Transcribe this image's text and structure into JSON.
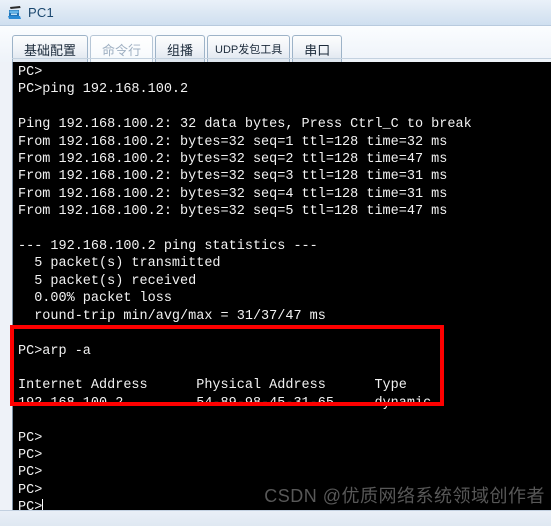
{
  "window": {
    "title": "PC1",
    "icon": "pc-device-icon"
  },
  "tabs": [
    {
      "label": "基础配置",
      "active": false,
      "name": "tab-basic-config"
    },
    {
      "label": "命令行",
      "active": true,
      "name": "tab-command-line"
    },
    {
      "label": "组播",
      "active": false,
      "name": "tab-multicast"
    },
    {
      "label": "UDP发包工具",
      "active": false,
      "name": "tab-udp-packet-tool"
    },
    {
      "label": "串口",
      "active": false,
      "name": "tab-serial-port"
    }
  ],
  "terminal": {
    "prompt": "PC>",
    "content": "PC>\nPC>ping 192.168.100.2\n\nPing 192.168.100.2: 32 data bytes, Press Ctrl_C to break\nFrom 192.168.100.2: bytes=32 seq=1 ttl=128 time=32 ms\nFrom 192.168.100.2: bytes=32 seq=2 ttl=128 time=47 ms\nFrom 192.168.100.2: bytes=32 seq=3 ttl=128 time=31 ms\nFrom 192.168.100.2: bytes=32 seq=4 ttl=128 time=31 ms\nFrom 192.168.100.2: bytes=32 seq=5 ttl=128 time=47 ms\n\n--- 192.168.100.2 ping statistics ---\n  5 packet(s) transmitted\n  5 packet(s) received\n  0.00% packet loss\n  round-trip min/avg/max = 31/37/47 ms\n\nPC>arp -a\n\nInternet Address      Physical Address      Type\n192.168.100.2         54-89-98-45-31-65     dynamic\n\nPC>\nPC>\nPC>\nPC>\nPC>",
    "ping_command": "ping 192.168.100.2",
    "ping_header": "Ping 192.168.100.2: 32 data bytes, Press Ctrl_C to break",
    "ping_replies": [
      "From 192.168.100.2: bytes=32 seq=1 ttl=128 time=32 ms",
      "From 192.168.100.2: bytes=32 seq=2 ttl=128 time=47 ms",
      "From 192.168.100.2: bytes=32 seq=3 ttl=128 time=31 ms",
      "From 192.168.100.2: bytes=32 seq=4 ttl=128 time=31 ms",
      "From 192.168.100.2: bytes=32 seq=5 ttl=128 time=47 ms"
    ],
    "stats_header": "--- 192.168.100.2 ping statistics ---",
    "stats": [
      "  5 packet(s) transmitted",
      "  5 packet(s) received",
      "  0.00% packet loss",
      "  round-trip min/avg/max = 31/37/47 ms"
    ],
    "arp_command": "arp -a",
    "arp_table": {
      "headers": [
        "Internet Address",
        "Physical Address",
        "Type"
      ],
      "rows": [
        [
          "192.168.100.2",
          "54-89-98-45-31-65",
          "dynamic"
        ]
      ]
    },
    "trailing_prompts": 5
  },
  "annotation": {
    "color": "#fe0000",
    "target": "arp-output-region"
  },
  "watermark": {
    "text": "CSDN @优质网络系统领域创作者"
  },
  "colors": {
    "terminal_bg": "#000000",
    "terminal_fg": "#f2f2f2",
    "title_text": "#19466e",
    "highlight": "#fe0000"
  }
}
